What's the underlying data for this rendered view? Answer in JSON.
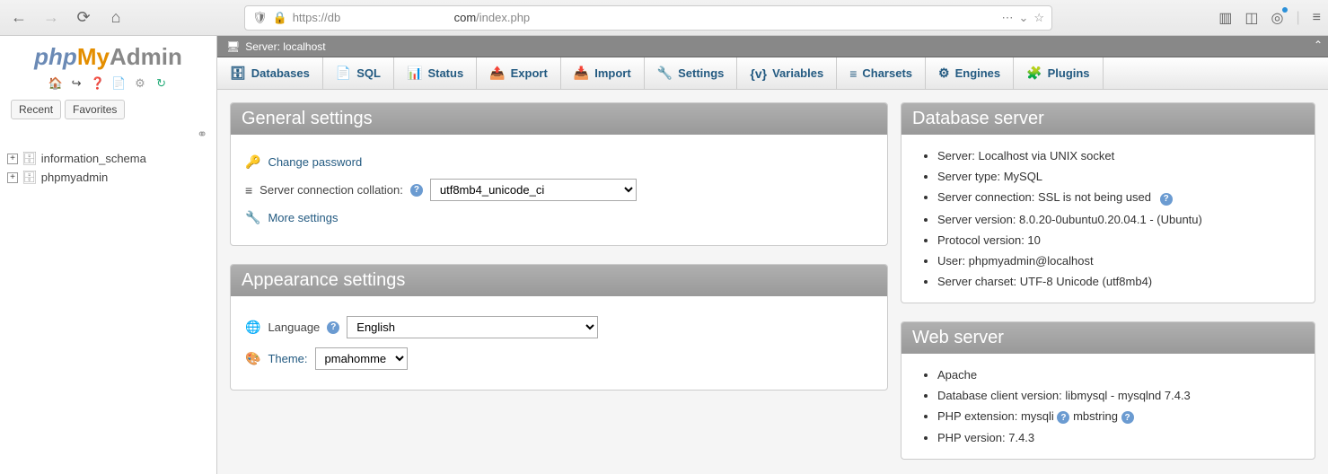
{
  "browser": {
    "url_prefix": "https://db",
    "url_mid": "com",
    "url_suffix": "/index.php"
  },
  "logo": {
    "p1": "php",
    "p2": "My",
    "p3": "Admin"
  },
  "side_tabs": {
    "recent": "Recent",
    "favorites": "Favorites"
  },
  "tree": {
    "items": [
      {
        "name": "information_schema"
      },
      {
        "name": "phpmyadmin"
      }
    ]
  },
  "server_bar": {
    "label": "Server: localhost"
  },
  "tabs": [
    {
      "icon": "🗄",
      "label": "Databases"
    },
    {
      "icon": "📄",
      "label": "SQL"
    },
    {
      "icon": "📊",
      "label": "Status"
    },
    {
      "icon": "📤",
      "label": "Export"
    },
    {
      "icon": "📥",
      "label": "Import"
    },
    {
      "icon": "🔧",
      "label": "Settings"
    },
    {
      "icon": "{v}",
      "label": "Variables"
    },
    {
      "icon": "≡",
      "label": "Charsets"
    },
    {
      "icon": "⚙",
      "label": "Engines"
    },
    {
      "icon": "🧩",
      "label": "Plugins"
    }
  ],
  "general": {
    "title": "General settings",
    "change_pw": "Change password",
    "collation_label": "Server connection collation:",
    "collation_value": "utf8mb4_unicode_ci",
    "more": "More settings"
  },
  "appearance": {
    "title": "Appearance settings",
    "lang_label": "Language",
    "lang_value": "English",
    "theme_label": "Theme:",
    "theme_value": "pmahomme"
  },
  "db_server": {
    "title": "Database server",
    "items": [
      "Server: Localhost via UNIX socket",
      "Server type: MySQL",
      "Server connection: SSL is not being used",
      "Server version: 8.0.20-0ubuntu0.20.04.1 - (Ubuntu)",
      "Protocol version: 10",
      "User: phpmyadmin@localhost",
      "Server charset: UTF-8 Unicode (utf8mb4)"
    ]
  },
  "web_server": {
    "title": "Web server",
    "item0": "Apache",
    "item1": "Database client version: libmysql - mysqlnd 7.4.3",
    "item2a": "PHP extension: mysqli",
    "item2b": "mbstring",
    "item3": "PHP version: 7.4.3"
  }
}
